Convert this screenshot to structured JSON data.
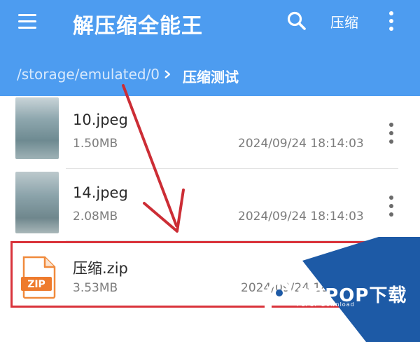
{
  "app_bar": {
    "title": "解压缩全能王",
    "compress_label": "压缩",
    "background": "#4d9cf0",
    "icons": [
      "menu-icon",
      "search-icon",
      "more-vertical-icon"
    ]
  },
  "breadcrumb": {
    "root": "/storage/emulated/0",
    "separator_icon": "chevron-right-icon",
    "current": "压缩测试"
  },
  "files": [
    {
      "name": "10.jpeg",
      "size": "1.50MB",
      "date": "2024/09/24 18:14:03",
      "icon": "image-thumbnail"
    },
    {
      "name": "14.jpeg",
      "size": "2.08MB",
      "date": "2024/09/24 18:14:03",
      "icon": "image-thumbnail"
    },
    {
      "name": "压缩.zip",
      "size": "3.53MB",
      "date": "2024/09/24 18:15",
      "icon": "zip-file-icon",
      "icon_label": "ZIP"
    }
  ],
  "annotation": {
    "highlight_color": "#d9333b",
    "arrow_color": "#cc2d35"
  },
  "watermark": {
    "brand": "PCPOP下载",
    "sub": "PCPOP Download",
    "color": "#1d5aa6"
  }
}
